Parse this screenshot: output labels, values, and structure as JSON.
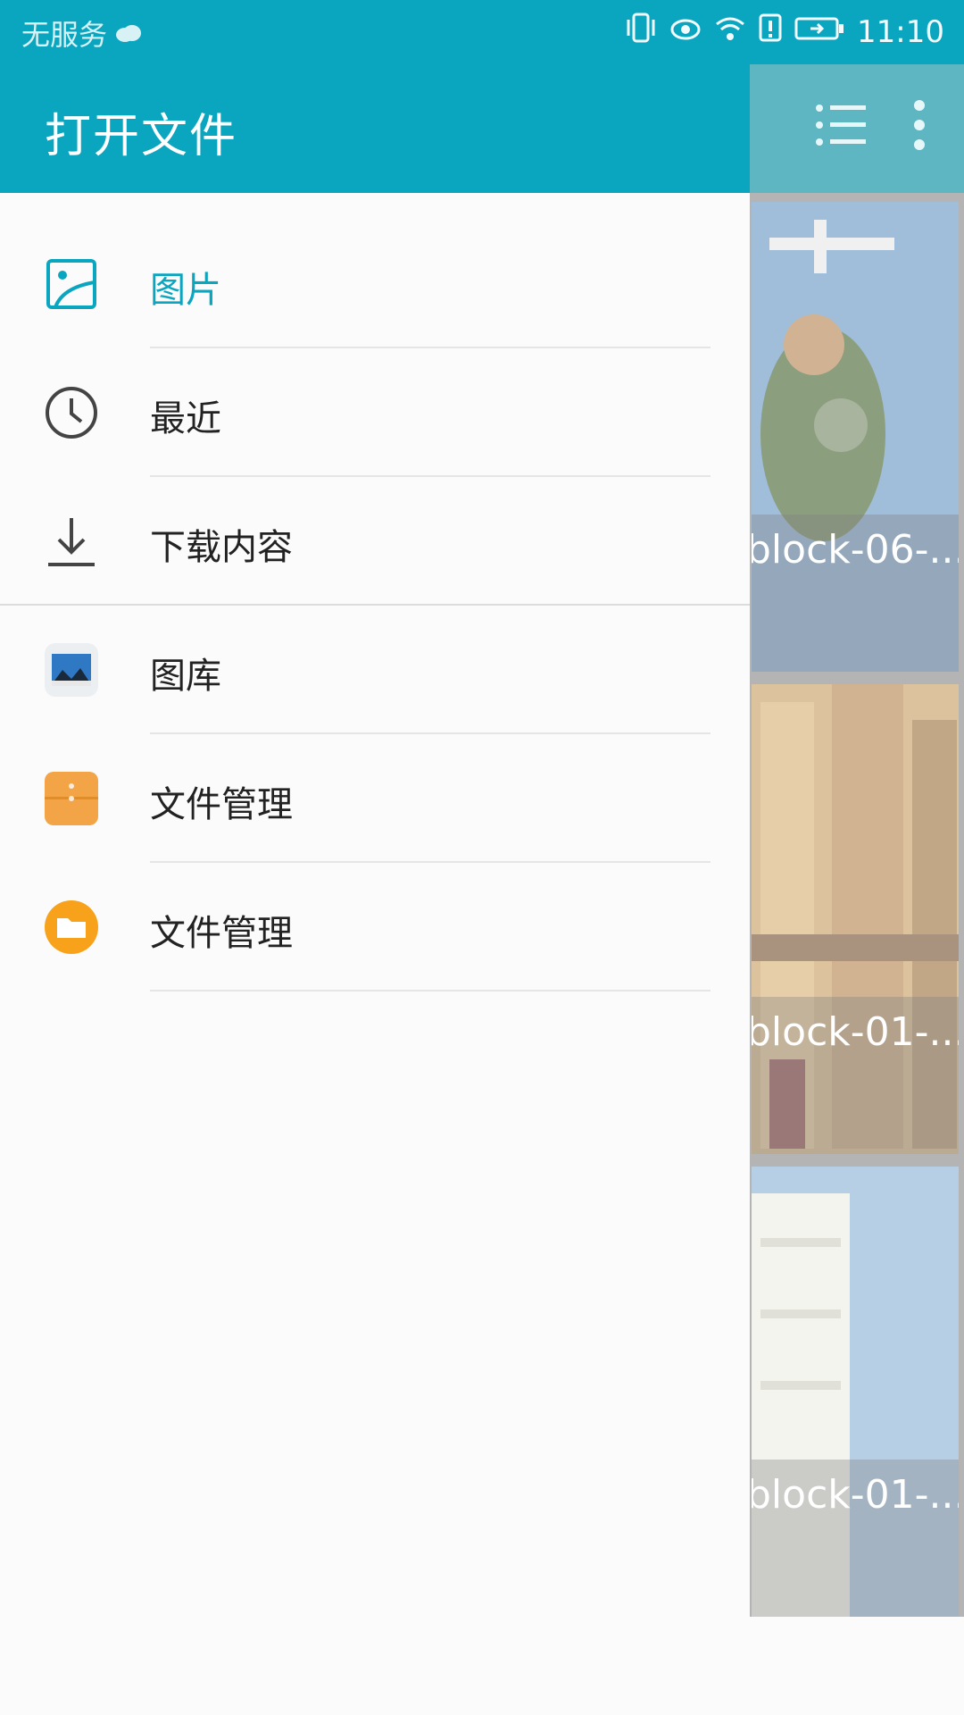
{
  "status_bar": {
    "carrier": "无服务",
    "time": "11:10",
    "icons": [
      "cloud-icon",
      "vibrate-icon",
      "eye-icon",
      "wifi-icon",
      "alert-icon",
      "battery-icon"
    ]
  },
  "drawer": {
    "title": "打开文件",
    "items": [
      {
        "label": "图片",
        "icon": "image-icon",
        "active": true
      },
      {
        "label": "最近",
        "icon": "clock-icon",
        "active": false
      },
      {
        "label": "下载内容",
        "icon": "download-icon",
        "active": false
      },
      {
        "label": "图库",
        "icon": "gallery-app-icon",
        "active": false
      },
      {
        "label": "文件管理",
        "icon": "file-manager-orange-icon",
        "active": false
      },
      {
        "label": "文件管理",
        "icon": "folder-app-icon",
        "active": false
      }
    ]
  },
  "toolbar": {
    "icons": [
      "list-view-icon",
      "more-vert-icon"
    ]
  },
  "thumbnails": [
    {
      "caption": "block-06-..."
    },
    {
      "caption": "block-01-..."
    },
    {
      "caption": "block-01-..."
    }
  ],
  "colors": {
    "accent": "#0aa6c0",
    "appbar_dim": "#0a8fa3"
  }
}
